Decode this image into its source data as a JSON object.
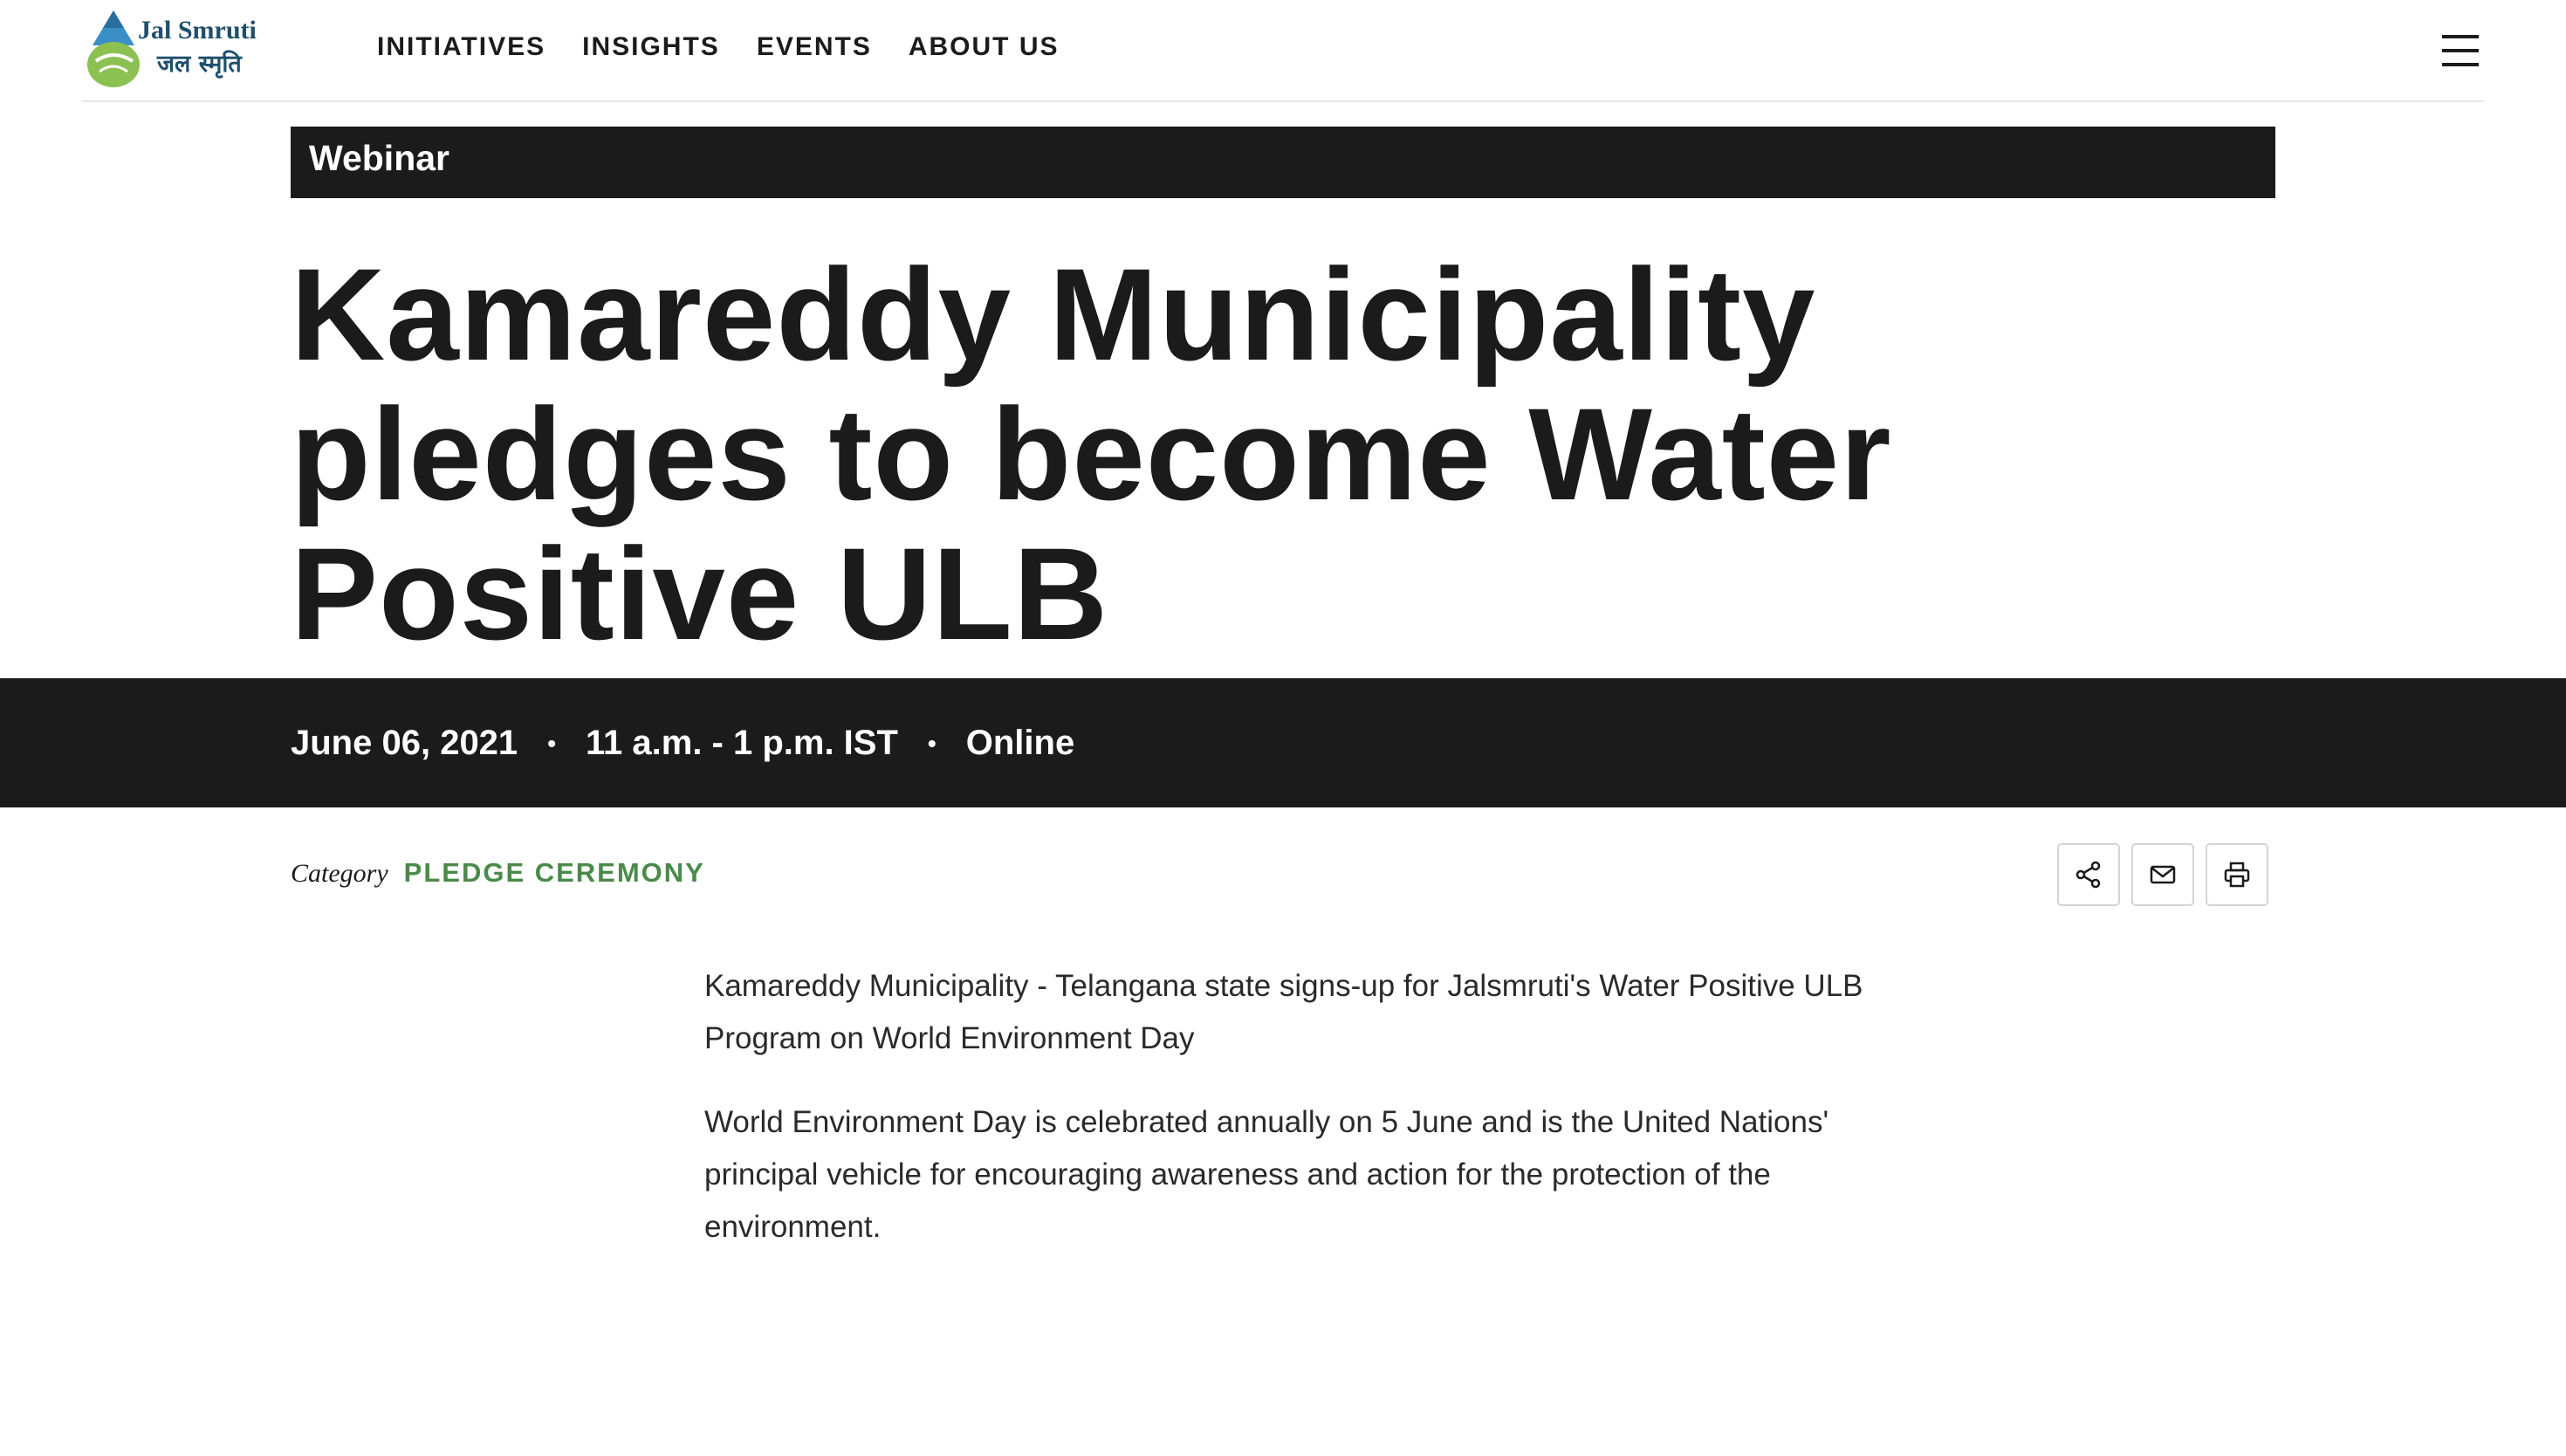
{
  "header": {
    "logo": {
      "name_en": "Jal Smruti",
      "name_hi": "जल स्मृति"
    },
    "nav": [
      {
        "label": "INITIATIVES"
      },
      {
        "label": "INSIGHTS"
      },
      {
        "label": "EVENTS"
      },
      {
        "label": "ABOUT US"
      }
    ],
    "menu_icon": "hamburger-menu-icon"
  },
  "event": {
    "type_label": "Webinar",
    "title": "Kamareddy Municipality pledges to become Water Positive ULB",
    "date": "June 06, 2021",
    "time": "11 a.m. - 1 p.m. IST",
    "location": "Online",
    "separator": "•",
    "category_label": "Category",
    "category_value": "PLEDGE CEREMONY"
  },
  "actions": {
    "share_icon": "share-icon",
    "email_icon": "mail-icon",
    "print_icon": "print-icon"
  },
  "body": {
    "paragraphs": [
      "Kamareddy Municipality - Telangana state signs-up for Jalsmruti's Water Positive ULB Program on World Environment Day",
      "World Environment Day is celebrated annually on 5 June and is the United Nations' principal vehicle for encouraging awareness and action for the protection of the environment."
    ]
  },
  "colors": {
    "dark": "#1b1b1b",
    "accent_green": "#4a8a4a",
    "logo_blue": "#1f4f6b",
    "logo_drop": "#3b8fc7",
    "logo_leaf": "#8cc152"
  }
}
